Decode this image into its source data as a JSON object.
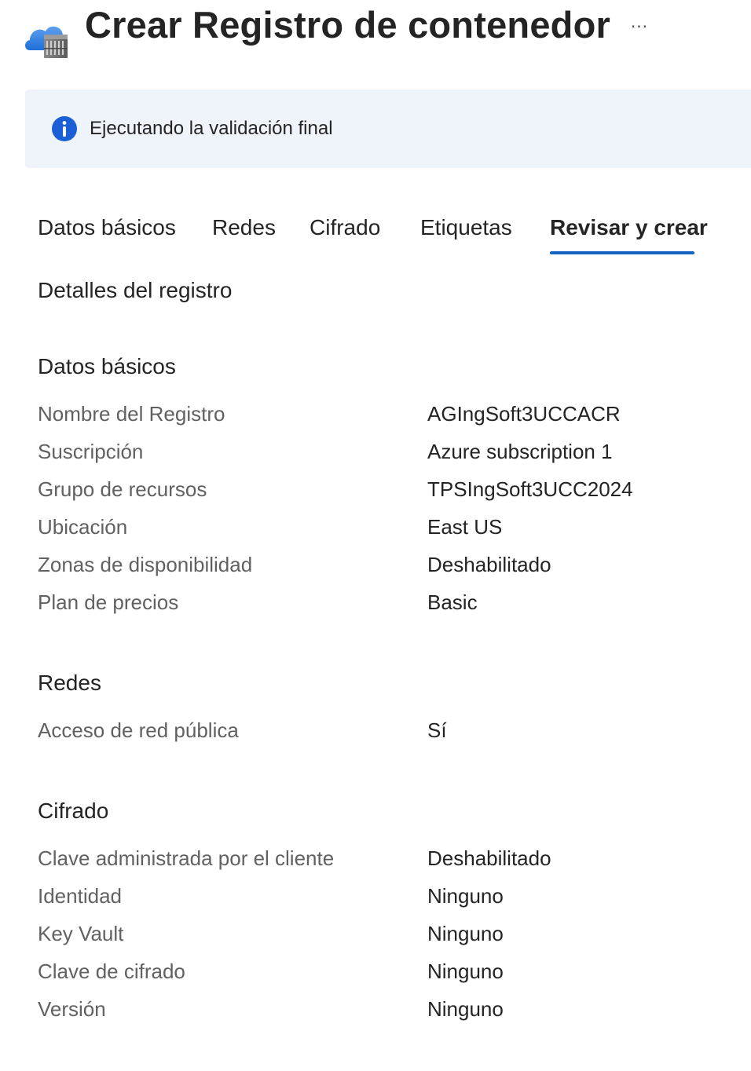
{
  "header": {
    "title": "Crear Registro de contenedor",
    "more_label": "···",
    "icon": "container-registry-icon"
  },
  "banner": {
    "icon": "info-icon",
    "message": "Ejecutando la validación final",
    "icon_color": "#1a5fd6",
    "background": "#eff4fb"
  },
  "tabs": [
    {
      "label": "Datos básicos",
      "active": false
    },
    {
      "label": "Redes",
      "active": false
    },
    {
      "label": "Cifrado",
      "active": false
    },
    {
      "label": "Etiquetas",
      "active": false
    },
    {
      "label": "Revisar y crear",
      "active": true
    }
  ],
  "accent_color": "#1565c0",
  "details_heading": "Detalles del registro",
  "sections": {
    "basics": {
      "title": "Datos básicos",
      "rows": [
        {
          "label": "Nombre del Registro",
          "value": "AGIngSoft3UCCACR"
        },
        {
          "label": "Suscripción",
          "value": "Azure subscription 1"
        },
        {
          "label": "Grupo de recursos",
          "value": "TPSIngSoft3UCC2024"
        },
        {
          "label": "Ubicación",
          "value": "East US"
        },
        {
          "label": "Zonas de disponibilidad",
          "value": "Deshabilitado"
        },
        {
          "label": "Plan de precios",
          "value": "Basic"
        }
      ]
    },
    "networking": {
      "title": "Redes",
      "rows": [
        {
          "label": "Acceso de red pública",
          "value": "Sí"
        }
      ]
    },
    "encryption": {
      "title": "Cifrado",
      "rows": [
        {
          "label": "Clave administrada por el cliente",
          "value": "Deshabilitado"
        },
        {
          "label": "Identidad",
          "value": "Ninguno"
        },
        {
          "label": "Key Vault",
          "value": "Ninguno"
        },
        {
          "label": "Clave de cifrado",
          "value": "Ninguno"
        },
        {
          "label": "Versión",
          "value": "Ninguno"
        }
      ]
    }
  }
}
